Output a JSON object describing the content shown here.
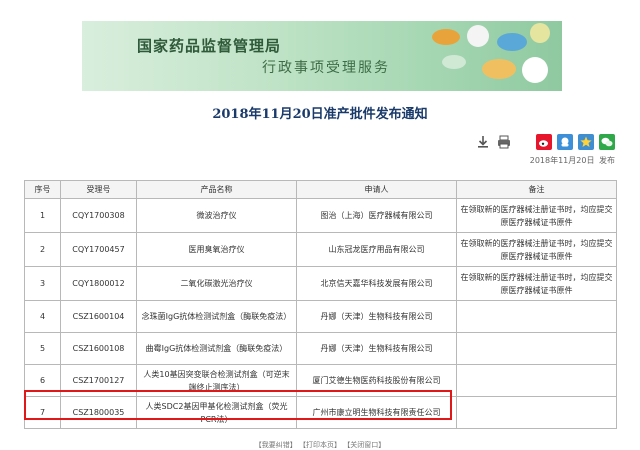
{
  "banner": {
    "title": "国家药品监督管理局",
    "subtitle": "行政事项受理服务"
  },
  "notice": {
    "title": "2018年11月20日准产批件发布通知",
    "date": "2018年11月20日",
    "publish_label": "发布"
  },
  "toolbar": {
    "icons": [
      "download-icon",
      "print-icon",
      "weibo-share-icon",
      "qq-share-icon",
      "star-share-icon",
      "wechat-share-icon"
    ]
  },
  "table": {
    "headers": [
      "序号",
      "受理号",
      "产品名称",
      "申请人",
      "备注"
    ],
    "rows": [
      {
        "no": "1",
        "id": "CQY1700308",
        "name": "微波治疗仪",
        "applicant": "图治（上海）医疗器械有限公司",
        "note": "在领取新的医疗器械注册证书时，均应提交原医疗器械证书原件"
      },
      {
        "no": "2",
        "id": "CQY1700457",
        "name": "医用臭氧治疗仪",
        "applicant": "山东冠龙医疗用品有限公司",
        "note": "在领取新的医疗器械注册证书时，均应提交原医疗器械证书原件"
      },
      {
        "no": "3",
        "id": "CQY1800012",
        "name": "二氧化碳激光治疗仪",
        "applicant": "北京信天嘉华科技发展有限公司",
        "note": "在领取新的医疗器械注册证书时，均应提交原医疗器械证书原件"
      },
      {
        "no": "4",
        "id": "CSZ1600104",
        "name": "念珠菌IgG抗体检测试剂盒（酶联免疫法）",
        "applicant": "丹娜（天津）生物科技有限公司",
        "note": ""
      },
      {
        "no": "5",
        "id": "CSZ1600108",
        "name": "曲霉IgG抗体检测试剂盒（酶联免疫法）",
        "applicant": "丹娜（天津）生物科技有限公司",
        "note": ""
      },
      {
        "no": "6",
        "id": "CSZ1700127",
        "name": "人类10基因突变联合检测试剂盒（可逆末端终止测序法）",
        "applicant": "厦门艾德生物医药科技股份有限公司",
        "note": ""
      },
      {
        "no": "7",
        "id": "CSZ1800035",
        "name": "人类SDC2基因甲基化检测试剂盒（荧光PCR法）",
        "applicant": "广州市康立明生物科技有限责任公司",
        "note": ""
      }
    ]
  },
  "footer": {
    "text": "【我要纠错】 【打印本页】 【关闭窗口】"
  },
  "colors": {
    "highlight": "#e01818",
    "title": "#1a3a6a",
    "banner": "#bfe3c6"
  }
}
